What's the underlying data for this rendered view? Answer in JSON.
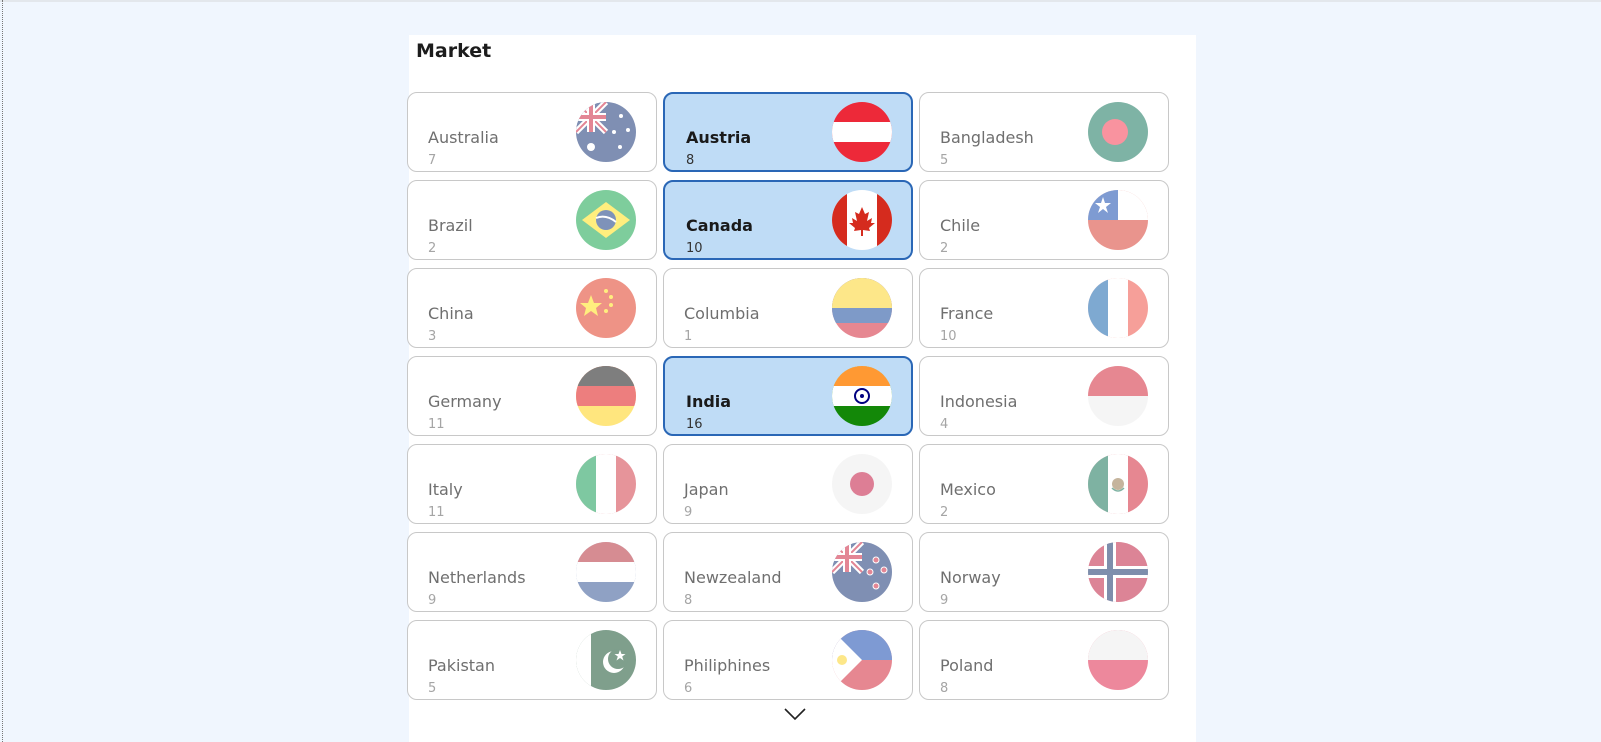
{
  "panel": {
    "title": "Market",
    "scroll_icon": "chevron-down-icon"
  },
  "markets": [
    {
      "name": "Australia",
      "count": "7",
      "selected": false,
      "flag_icon": "australia-flag-icon"
    },
    {
      "name": "Austria",
      "count": "8",
      "selected": true,
      "flag_icon": "austria-flag-icon"
    },
    {
      "name": "Bangladesh",
      "count": "5",
      "selected": false,
      "flag_icon": "bangladesh-flag-icon"
    },
    {
      "name": "Brazil",
      "count": "2",
      "selected": false,
      "flag_icon": "brazil-flag-icon"
    },
    {
      "name": "Canada",
      "count": "10",
      "selected": true,
      "flag_icon": "canada-flag-icon"
    },
    {
      "name": "Chile",
      "count": "2",
      "selected": false,
      "flag_icon": "chile-flag-icon"
    },
    {
      "name": "China",
      "count": "3",
      "selected": false,
      "flag_icon": "china-flag-icon"
    },
    {
      "name": "Columbia",
      "count": "1",
      "selected": false,
      "flag_icon": "columbia-flag-icon"
    },
    {
      "name": "France",
      "count": "10",
      "selected": false,
      "flag_icon": "france-flag-icon"
    },
    {
      "name": "Germany",
      "count": "11",
      "selected": false,
      "flag_icon": "germany-flag-icon"
    },
    {
      "name": "India",
      "count": "16",
      "selected": true,
      "flag_icon": "india-flag-icon"
    },
    {
      "name": "Indonesia",
      "count": "4",
      "selected": false,
      "flag_icon": "indonesia-flag-icon"
    },
    {
      "name": "Italy",
      "count": "11",
      "selected": false,
      "flag_icon": "italy-flag-icon"
    },
    {
      "name": "Japan",
      "count": "9",
      "selected": false,
      "flag_icon": "japan-flag-icon"
    },
    {
      "name": "Mexico",
      "count": "2",
      "selected": false,
      "flag_icon": "mexico-flag-icon"
    },
    {
      "name": "Netherlands",
      "count": "9",
      "selected": false,
      "flag_icon": "netherlands-flag-icon"
    },
    {
      "name": "Newzealand",
      "count": "8",
      "selected": false,
      "flag_icon": "newzealand-flag-icon"
    },
    {
      "name": "Norway",
      "count": "9",
      "selected": false,
      "flag_icon": "norway-flag-icon"
    },
    {
      "name": "Pakistan",
      "count": "5",
      "selected": false,
      "flag_icon": "pakistan-flag-icon"
    },
    {
      "name": "Philiphines",
      "count": "6",
      "selected": false,
      "flag_icon": "philiphines-flag-icon"
    },
    {
      "name": "Poland",
      "count": "8",
      "selected": false,
      "flag_icon": "poland-flag-icon"
    }
  ],
  "colors": {
    "selected_background": "#bfdcf6",
    "selected_border": "#2a67b6",
    "page_background": "#f0f6fe"
  }
}
